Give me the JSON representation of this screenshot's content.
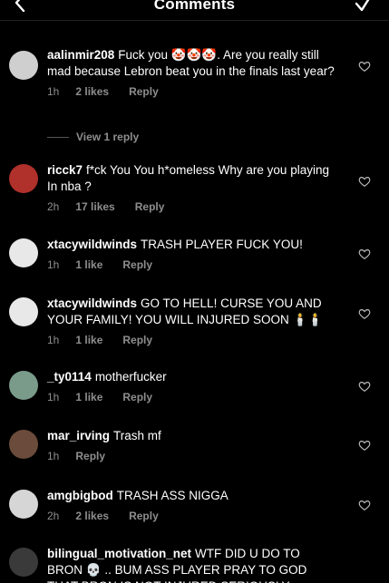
{
  "header": {
    "title": "Comments"
  },
  "comments": [
    {
      "username": "aalinmir208",
      "text": "Fuck you 🤡🤡🤡. Are you really still mad because Lebron beat you in the finals last year?",
      "time": "1h",
      "likes": "2 likes",
      "reply": "Reply",
      "avatar_color": "#cfcfcf"
    },
    {
      "username": "ricck7",
      "text": "f*ck You You h*omeless Why are you playing In nba ?",
      "time": "2h",
      "likes": "17 likes",
      "reply": "Reply",
      "avatar_color": "#b0302b"
    },
    {
      "username": "xtacywildwinds",
      "text": "TRASH PLAYER FUCK YOU!",
      "time": "1h",
      "likes": "1 like",
      "reply": "Reply",
      "avatar_color": "#e8e8e8"
    },
    {
      "username": "xtacywildwinds",
      "text": "GO TO HELL! CURSE YOU AND YOUR FAMILY! YOU WILL INJURED SOON 🕯️🕯️",
      "time": "1h",
      "likes": "1 like",
      "reply": "Reply",
      "avatar_color": "#e8e8e8"
    },
    {
      "username": "_ty0114",
      "text": "motherfucker",
      "time": "1h",
      "likes": "1 like",
      "reply": "Reply",
      "avatar_color": "#7a9b8a"
    },
    {
      "username": "mar_irving",
      "text": "Trash mf",
      "time": "1h",
      "likes": "",
      "reply": "Reply",
      "avatar_color": "#6b4b3b"
    },
    {
      "username": "amgbigbod",
      "text": "TRASH ASS NIGGA",
      "time": "2h",
      "likes": "2 likes",
      "reply": "Reply",
      "avatar_color": "#d6d6d6"
    },
    {
      "username": "bilingual_motivation_net",
      "text": "WTF DID U DO TO BRON 💀 .. BUM ASS PLAYER PRAY TO GOD THAT BRON IS NOT INJURED SERIOUSLY",
      "time": "",
      "likes": "",
      "reply": "",
      "avatar_color": "#3a3a3a"
    }
  ],
  "view_replies": "View 1 reply"
}
